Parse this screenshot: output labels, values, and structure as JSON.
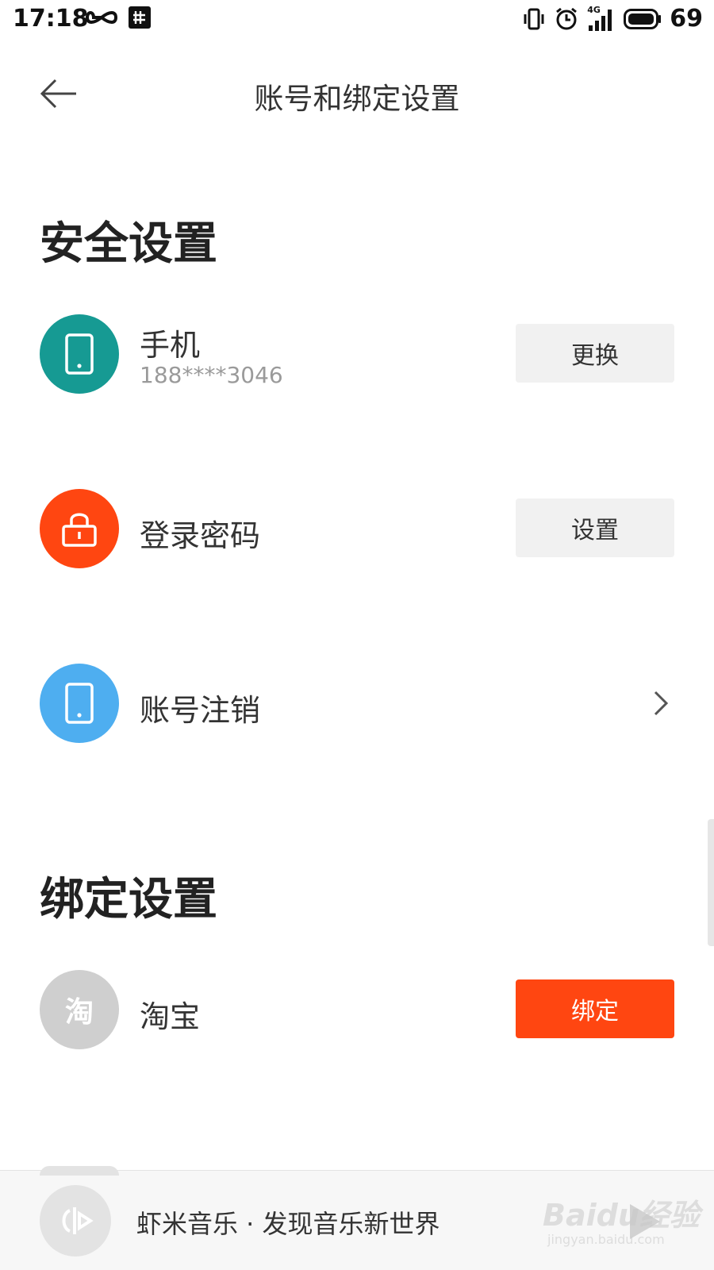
{
  "status_bar": {
    "time": "17:18",
    "network": "4G",
    "battery": "69"
  },
  "header": {
    "title": "账号和绑定设置",
    "back_icon": "arrow-left-icon"
  },
  "security": {
    "heading": "安全设置",
    "phone": {
      "title": "手机",
      "number": "188****3046",
      "button": "更换",
      "icon": "phone-icon",
      "color": "#169a93"
    },
    "password": {
      "title": "登录密码",
      "button": "设置",
      "icon": "lock-icon",
      "color": "#ff4611"
    },
    "cancel_account": {
      "title": "账号注销",
      "icon": "phone-icon",
      "color": "#4eaef0"
    }
  },
  "binding": {
    "heading": "绑定设置",
    "taobao": {
      "title": "淘宝",
      "glyph": "淘",
      "button": "绑定",
      "color": "#cfcfcf"
    }
  },
  "music_banner": {
    "text": "虾米音乐 · 发现音乐新世界"
  },
  "watermark": {
    "brand": "Baidu经验",
    "url": "jingyan.baidu.com"
  },
  "colors": {
    "accent": "#ff4611",
    "button_bg": "#f1f1f1"
  }
}
